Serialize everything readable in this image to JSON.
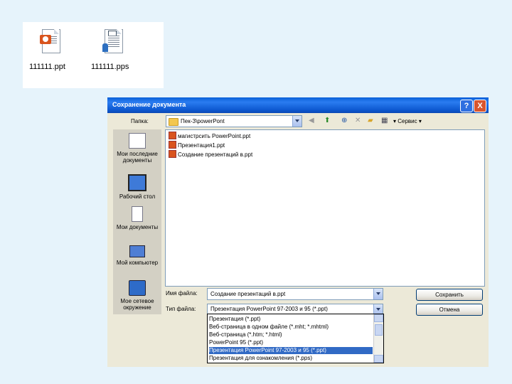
{
  "files": [
    {
      "name": "111111.ppt",
      "icon": "ppt-file-icon"
    },
    {
      "name": "111111.pps",
      "icon": "pps-file-icon"
    }
  ],
  "dialog": {
    "title": "Сохранение документа",
    "help_label": "?",
    "close_label": "X",
    "folder_label": "Папка:",
    "folder_value": "Пек-З\\powerPont",
    "service_label": "▾ Сервис ▾",
    "places": [
      {
        "label": "Мои последние документы",
        "icon": "recent-documents-icon"
      },
      {
        "label": "Рабочий стол",
        "icon": "desktop-icon"
      },
      {
        "label": "Мои документы",
        "icon": "my-documents-icon"
      },
      {
        "label": "Мой компьютер",
        "icon": "my-computer-icon"
      },
      {
        "label": "Мое сетевое окружение",
        "icon": "network-places-icon"
      }
    ],
    "file_list": [
      "магистрсить PowerPoint.ppt",
      "Презентация1.ppt",
      "Создание презентаций в.ppt"
    ],
    "filename_label": "Имя файла:",
    "filename_value": "Создание презентаций в.ppt",
    "filetype_label": "Тип файла:",
    "filetype_value": "Презентация PowerPoint 97-2003 и 95 (*.ppt)",
    "save_label": "Сохранить",
    "cancel_label": "Отмена",
    "filetype_options": [
      "Презентация (*.ppt)",
      "Веб-страница в одном файле (*.mht; *.mhtml)",
      "Веб-страница (*.htm; *.html)",
      "PowerPoint 95 (*.ppt)",
      "Презентация PowerPoint 97-2003 и 95 (*.ppt)",
      "Презентация для ознакомления (*.pps)"
    ],
    "selected_option_index": 4
  }
}
